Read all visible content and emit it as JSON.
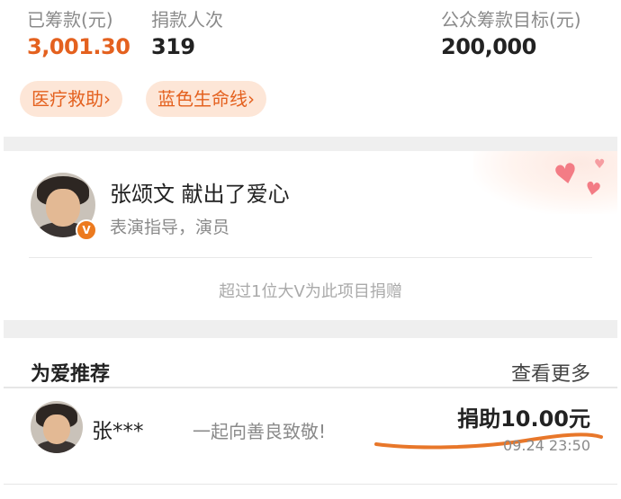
{
  "stats": {
    "raised_label": "已筹款(元)",
    "raised_value": "3,001.30",
    "donors_label": "捐款人次",
    "donors_value": "319",
    "target_label": "公众筹款目标(元)",
    "target_value": "200,000"
  },
  "tags": [
    {
      "label": "医疗救助›"
    },
    {
      "label": "蓝色生命线›"
    }
  ],
  "celebrity": {
    "name_line": "张颂文 献出了爱心",
    "role": "表演指导，演员",
    "badge": "V",
    "more_text": "超过1位大V为此项目捐赠"
  },
  "recommend": {
    "title": "为爱推荐",
    "more": "查看更多"
  },
  "donation": {
    "donor": "张***",
    "message": "一起向善良致敬!",
    "amount": "捐助10.00元",
    "time": "09.24 23:50"
  },
  "colors": {
    "accent_orange": "#e4611f",
    "tag_bg": "#fde6d7",
    "heart": "#f37c85",
    "separator": "#efefef"
  },
  "icons": {
    "verified_badge": "v-badge-icon",
    "hearts": "heart-icon"
  }
}
